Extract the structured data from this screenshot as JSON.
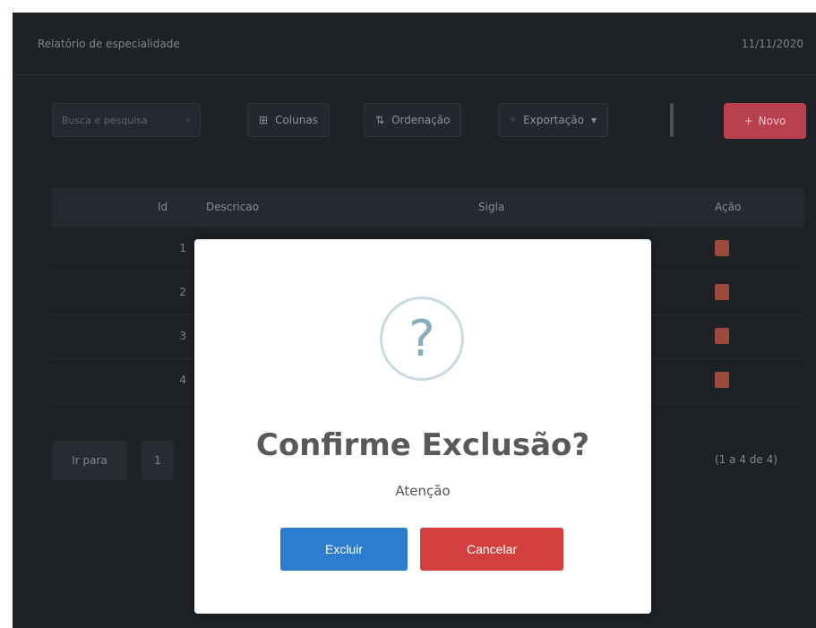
{
  "header": {
    "title": "Relatório de especialidade",
    "date": "11/11/2020"
  },
  "toolbar": {
    "search_placeholder": "Busca e pesquisa",
    "columns_label": "Colunas",
    "sort_label": "Ordenação",
    "export_label": "Exportação",
    "new_label": "Novo"
  },
  "table": {
    "columns": [
      "Id",
      "Descricao",
      "Sigla",
      "Ação"
    ],
    "rows": [
      {
        "id": "1"
      },
      {
        "id": "2"
      },
      {
        "id": "3"
      },
      {
        "id": "4"
      }
    ]
  },
  "pager": {
    "goto_label": "Ir para",
    "page": "1",
    "info": "(1 a 4 de 4)"
  },
  "modal": {
    "icon": "?",
    "title": "Confirme Exclusão?",
    "text": "Atenção",
    "confirm_label": "Excluir",
    "cancel_label": "Cancelar"
  },
  "colors": {
    "app_bg": "#1e2227",
    "danger": "#d33f3f",
    "primary": "#2c7cd0",
    "new_button": "#b8404f"
  },
  "icons": [
    "search-icon",
    "columns-icon",
    "sort-icon",
    "export-icon",
    "chevron-down-icon",
    "plus-icon",
    "delete-icon",
    "question-icon"
  ]
}
